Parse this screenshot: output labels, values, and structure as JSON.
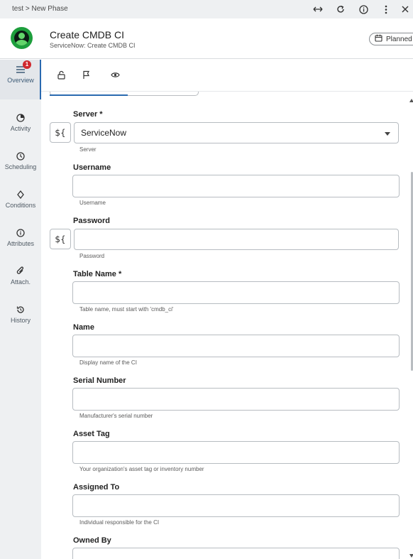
{
  "breadcrumb": "test > New Phase",
  "top_icons": [
    "expand-horizontal-icon",
    "refresh-icon",
    "info-icon",
    "more-vertical-icon",
    "close-icon"
  ],
  "header": {
    "title": "Create CMDB CI",
    "subtitle": "ServiceNow: Create CMDB CI",
    "status": "Planned",
    "status_icon": "calendar-icon"
  },
  "sidebar": {
    "items": [
      {
        "label": "Overview",
        "icon": "list-icon",
        "badge": "1"
      },
      {
        "label": "Activity",
        "icon": "pie-icon"
      },
      {
        "label": "Scheduling",
        "icon": "clock-icon"
      },
      {
        "label": "Conditions",
        "icon": "diamond-icon"
      },
      {
        "label": "Attributes",
        "icon": "info-icon"
      },
      {
        "label": "Attach.",
        "icon": "paperclip-icon"
      },
      {
        "label": "History",
        "icon": "history-icon"
      }
    ]
  },
  "toolbar": {
    "icons": [
      "lock-icon",
      "flag-icon",
      "eye-icon"
    ]
  },
  "form": {
    "var_button": "${",
    "fields": [
      {
        "label": "Server *",
        "value": "ServiceNow",
        "helper": "Server"
      },
      {
        "label": "Username",
        "value": "",
        "helper": "Username"
      },
      {
        "label": "Password",
        "value": "",
        "helper": "Password"
      },
      {
        "label": "Table Name *",
        "value": "",
        "helper": "Table name, must start with 'cmdb_ci'"
      },
      {
        "label": "Name",
        "value": "",
        "helper": "Display name of the CI"
      },
      {
        "label": "Serial Number",
        "value": "",
        "helper": "Manufacturer's serial number"
      },
      {
        "label": "Asset Tag",
        "value": "",
        "helper": "Your organization's asset tag or inventory number"
      },
      {
        "label": "Assigned To",
        "value": "",
        "helper": "Individual responsible for the CI"
      },
      {
        "label": "Owned By",
        "value": "",
        "helper": ""
      }
    ]
  },
  "colors": {
    "accent": "#2a6ab0",
    "logo": "#1d9e3c",
    "badge": "#d0282e"
  }
}
